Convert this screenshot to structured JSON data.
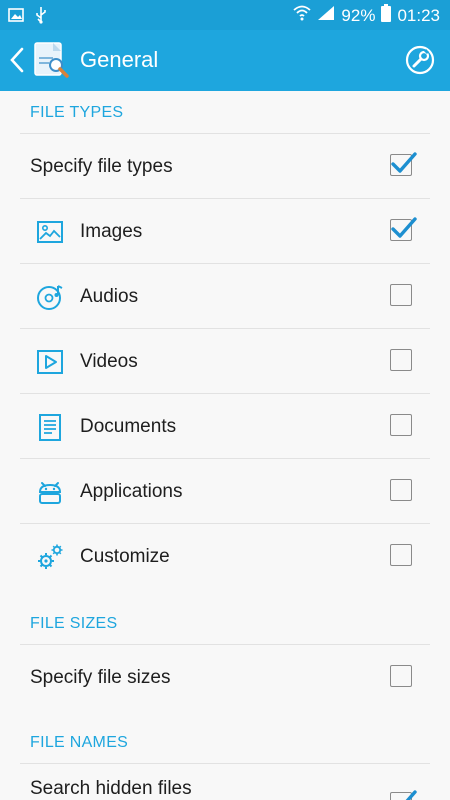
{
  "status_bar": {
    "battery": "92%",
    "time": "01:23"
  },
  "app_bar": {
    "title": "General"
  },
  "sections": {
    "file_types": {
      "header": "FILE TYPES",
      "specify_label": "Specify file types",
      "items": [
        {
          "label": "Images",
          "checked": true
        },
        {
          "label": "Audios",
          "checked": false
        },
        {
          "label": "Videos",
          "checked": false
        },
        {
          "label": "Documents",
          "checked": false
        },
        {
          "label": "Applications",
          "checked": false
        },
        {
          "label": "Customize",
          "checked": false
        }
      ]
    },
    "file_sizes": {
      "header": "FILE SIZES",
      "specify_label": "Specify file sizes"
    },
    "file_names": {
      "header": "FILE NAMES",
      "hidden_label": "Search hidden files"
    }
  },
  "colors": {
    "accent": "#1ea6de",
    "status_bar": "#1b9fd6",
    "check": "#1d8fd0"
  }
}
